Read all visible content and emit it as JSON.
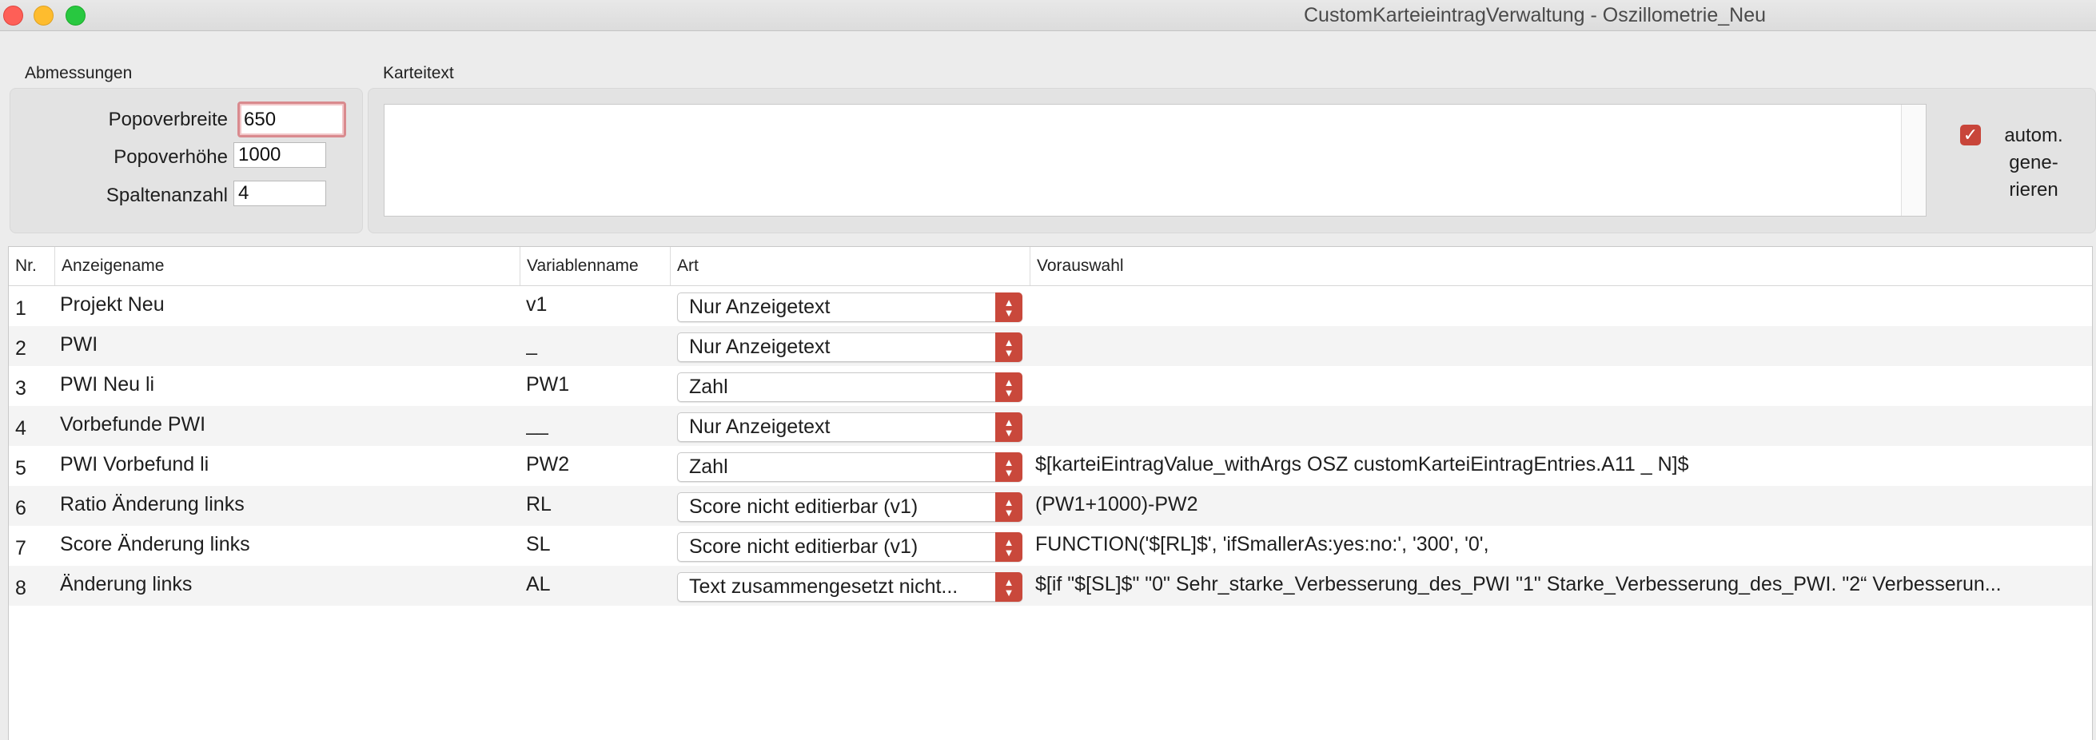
{
  "window": {
    "title": "CustomKarteieintragVerwaltung - Oszillometrie_Neu"
  },
  "dimensions": {
    "label": "Abmessungen",
    "fields": [
      {
        "label": "Popoverbreite",
        "value": "650"
      },
      {
        "label": "Popoverhöhe",
        "value": "1000"
      },
      {
        "label": "Spaltenanzahl",
        "value": "4"
      }
    ]
  },
  "karteitext": {
    "label": "Karteitext",
    "value": "",
    "auto_checkbox": {
      "checked": true,
      "line1": "autom.",
      "line2": "gene-",
      "line3": "rieren"
    }
  },
  "table": {
    "columns": [
      "Nr.",
      "Anzeigename",
      "Variablenname",
      "Art",
      "Vorauswahl"
    ],
    "rows": [
      {
        "nr": "1",
        "name": "Projekt Neu",
        "var": "v1",
        "art": "Nur Anzeigetext",
        "pre": ""
      },
      {
        "nr": "2",
        "name": "PWI",
        "var": "_",
        "art": "Nur Anzeigetext",
        "pre": ""
      },
      {
        "nr": "3",
        "name": "PWI Neu li",
        "var": "PW1",
        "art": "Zahl",
        "pre": ""
      },
      {
        "nr": "4",
        "name": "Vorbefunde PWI",
        "var": "__",
        "art": "Nur Anzeigetext",
        "pre": ""
      },
      {
        "nr": "5",
        "name": "PWI Vorbefund li",
        "var": "PW2",
        "art": "Zahl",
        "pre": "$[karteiEintragValue_withArgs OSZ customKarteiEintragEntries.A11 _ N]$"
      },
      {
        "nr": "6",
        "name": "Ratio Änderung links",
        "var": "RL",
        "art": "Score nicht editierbar (v1)",
        "pre": "(PW1+1000)-PW2"
      },
      {
        "nr": "7",
        "name": "Score Änderung links",
        "var": "SL",
        "art": "Score nicht editierbar (v1)",
        "pre": "FUNCTION('$[RL]$', 'ifSmallerAs:yes:no:', '300', '0',"
      },
      {
        "nr": "8",
        "name": "Änderung links",
        "var": "AL",
        "art": "Text zusammengesetzt nicht...",
        "pre": "$[if \"$[SL]$\"  \"0\" Sehr_starke_Verbesserung_des_PWI \"1\" Starke_Verbesserung_des_PWI. \"2“ Verbesserun..."
      }
    ]
  },
  "colors": {
    "accent": "#c9483b",
    "focus_ring": "#d98a8e"
  },
  "icons": {
    "popup_arrows": "chevron-up-down-icon",
    "checkbox": "checkmark-icon"
  }
}
